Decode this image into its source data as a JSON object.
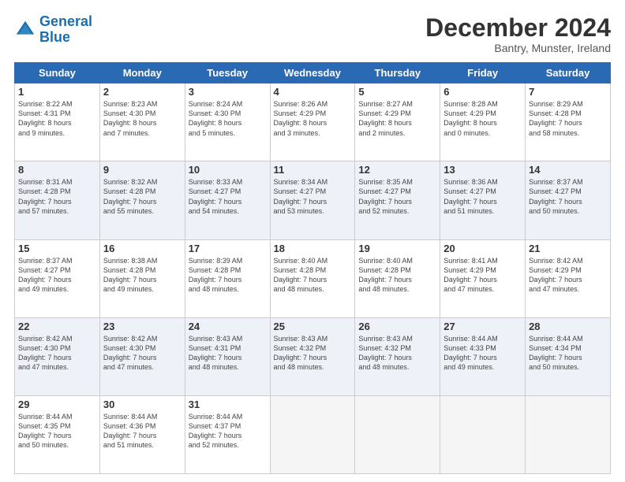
{
  "header": {
    "logo_line1": "General",
    "logo_line2": "Blue",
    "month": "December 2024",
    "location": "Bantry, Munster, Ireland"
  },
  "days_of_week": [
    "Sunday",
    "Monday",
    "Tuesday",
    "Wednesday",
    "Thursday",
    "Friday",
    "Saturday"
  ],
  "weeks": [
    [
      {
        "day": "1",
        "text": "Sunrise: 8:22 AM\nSunset: 4:31 PM\nDaylight: 8 hours\nand 9 minutes."
      },
      {
        "day": "2",
        "text": "Sunrise: 8:23 AM\nSunset: 4:30 PM\nDaylight: 8 hours\nand 7 minutes."
      },
      {
        "day": "3",
        "text": "Sunrise: 8:24 AM\nSunset: 4:30 PM\nDaylight: 8 hours\nand 5 minutes."
      },
      {
        "day": "4",
        "text": "Sunrise: 8:26 AM\nSunset: 4:29 PM\nDaylight: 8 hours\nand 3 minutes."
      },
      {
        "day": "5",
        "text": "Sunrise: 8:27 AM\nSunset: 4:29 PM\nDaylight: 8 hours\nand 2 minutes."
      },
      {
        "day": "6",
        "text": "Sunrise: 8:28 AM\nSunset: 4:29 PM\nDaylight: 8 hours\nand 0 minutes."
      },
      {
        "day": "7",
        "text": "Sunrise: 8:29 AM\nSunset: 4:28 PM\nDaylight: 7 hours\nand 58 minutes."
      }
    ],
    [
      {
        "day": "8",
        "text": "Sunrise: 8:31 AM\nSunset: 4:28 PM\nDaylight: 7 hours\nand 57 minutes."
      },
      {
        "day": "9",
        "text": "Sunrise: 8:32 AM\nSunset: 4:28 PM\nDaylight: 7 hours\nand 55 minutes."
      },
      {
        "day": "10",
        "text": "Sunrise: 8:33 AM\nSunset: 4:27 PM\nDaylight: 7 hours\nand 54 minutes."
      },
      {
        "day": "11",
        "text": "Sunrise: 8:34 AM\nSunset: 4:27 PM\nDaylight: 7 hours\nand 53 minutes."
      },
      {
        "day": "12",
        "text": "Sunrise: 8:35 AM\nSunset: 4:27 PM\nDaylight: 7 hours\nand 52 minutes."
      },
      {
        "day": "13",
        "text": "Sunrise: 8:36 AM\nSunset: 4:27 PM\nDaylight: 7 hours\nand 51 minutes."
      },
      {
        "day": "14",
        "text": "Sunrise: 8:37 AM\nSunset: 4:27 PM\nDaylight: 7 hours\nand 50 minutes."
      }
    ],
    [
      {
        "day": "15",
        "text": "Sunrise: 8:37 AM\nSunset: 4:27 PM\nDaylight: 7 hours\nand 49 minutes."
      },
      {
        "day": "16",
        "text": "Sunrise: 8:38 AM\nSunset: 4:28 PM\nDaylight: 7 hours\nand 49 minutes."
      },
      {
        "day": "17",
        "text": "Sunrise: 8:39 AM\nSunset: 4:28 PM\nDaylight: 7 hours\nand 48 minutes."
      },
      {
        "day": "18",
        "text": "Sunrise: 8:40 AM\nSunset: 4:28 PM\nDaylight: 7 hours\nand 48 minutes."
      },
      {
        "day": "19",
        "text": "Sunrise: 8:40 AM\nSunset: 4:28 PM\nDaylight: 7 hours\nand 48 minutes."
      },
      {
        "day": "20",
        "text": "Sunrise: 8:41 AM\nSunset: 4:29 PM\nDaylight: 7 hours\nand 47 minutes."
      },
      {
        "day": "21",
        "text": "Sunrise: 8:42 AM\nSunset: 4:29 PM\nDaylight: 7 hours\nand 47 minutes."
      }
    ],
    [
      {
        "day": "22",
        "text": "Sunrise: 8:42 AM\nSunset: 4:30 PM\nDaylight: 7 hours\nand 47 minutes."
      },
      {
        "day": "23",
        "text": "Sunrise: 8:42 AM\nSunset: 4:30 PM\nDaylight: 7 hours\nand 47 minutes."
      },
      {
        "day": "24",
        "text": "Sunrise: 8:43 AM\nSunset: 4:31 PM\nDaylight: 7 hours\nand 48 minutes."
      },
      {
        "day": "25",
        "text": "Sunrise: 8:43 AM\nSunset: 4:32 PM\nDaylight: 7 hours\nand 48 minutes."
      },
      {
        "day": "26",
        "text": "Sunrise: 8:43 AM\nSunset: 4:32 PM\nDaylight: 7 hours\nand 48 minutes."
      },
      {
        "day": "27",
        "text": "Sunrise: 8:44 AM\nSunset: 4:33 PM\nDaylight: 7 hours\nand 49 minutes."
      },
      {
        "day": "28",
        "text": "Sunrise: 8:44 AM\nSunset: 4:34 PM\nDaylight: 7 hours\nand 50 minutes."
      }
    ],
    [
      {
        "day": "29",
        "text": "Sunrise: 8:44 AM\nSunset: 4:35 PM\nDaylight: 7 hours\nand 50 minutes."
      },
      {
        "day": "30",
        "text": "Sunrise: 8:44 AM\nSunset: 4:36 PM\nDaylight: 7 hours\nand 51 minutes."
      },
      {
        "day": "31",
        "text": "Sunrise: 8:44 AM\nSunset: 4:37 PM\nDaylight: 7 hours\nand 52 minutes."
      },
      {
        "day": "",
        "text": ""
      },
      {
        "day": "",
        "text": ""
      },
      {
        "day": "",
        "text": ""
      },
      {
        "day": "",
        "text": ""
      }
    ]
  ]
}
